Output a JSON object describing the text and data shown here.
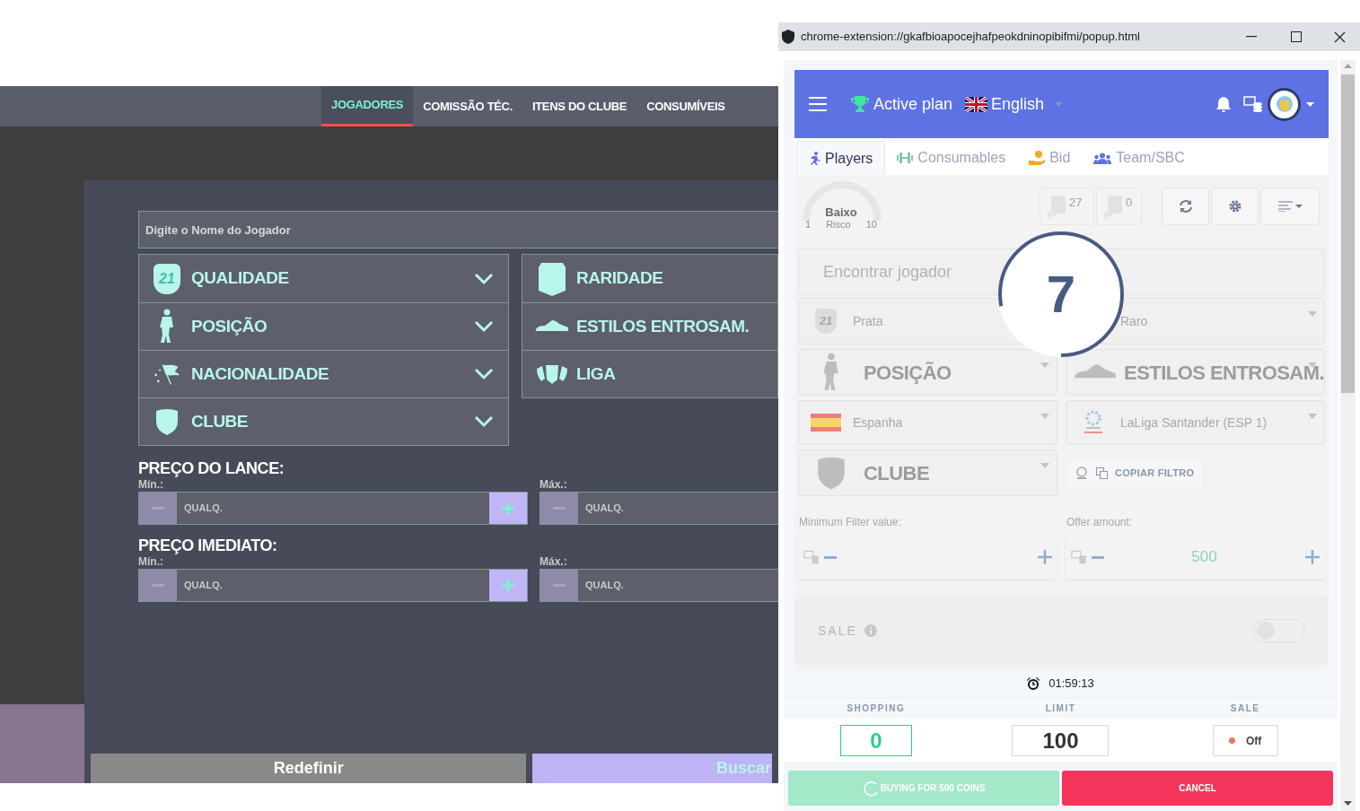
{
  "game": {
    "nav_tabs": [
      {
        "label": "JOGADORES",
        "selected": true
      },
      {
        "label": "COMISSÃO TÉC.",
        "selected": false
      },
      {
        "label": "ITENS DO CLUBE",
        "selected": false
      },
      {
        "label": "CONSUMÍVEIS",
        "selected": false
      }
    ],
    "search": {
      "placeholder": "Digite o Nome do Jogador"
    },
    "filters_left": [
      {
        "kind": "quality",
        "label": "QUALIDADE",
        "badge": "21"
      },
      {
        "kind": "position",
        "label": "POSIÇÃO"
      },
      {
        "kind": "nation",
        "label": "NACIONALIDADE"
      },
      {
        "kind": "club",
        "label": "CLUBE"
      }
    ],
    "filters_right": [
      {
        "kind": "rarity",
        "label": "RARIDADE"
      },
      {
        "kind": "chemistry",
        "label": "ESTILOS ENTROSAM."
      },
      {
        "kind": "league",
        "label": "LIGA"
      }
    ],
    "prices": [
      {
        "title": "PREÇO DO LANCE:",
        "min_label": "Mín.:",
        "max_label": "Máx.:",
        "min_placeholder": "QUALQ.",
        "max_placeholder": "QUALQ."
      },
      {
        "title": "PREÇO IMEDIATO:",
        "min_label": "Mín.:",
        "max_label": "Máx.:",
        "min_placeholder": "QUALQ.",
        "max_placeholder": "QUALQ."
      }
    ],
    "reset_button": "Redefinir",
    "search_button": "Buscar"
  },
  "popup": {
    "window": {
      "title": "chrome-extension://gkafbioapocejhafpeokdninopibifmi/popup.html"
    },
    "header": {
      "plan": "Active plan",
      "language": "English"
    },
    "tabs": [
      {
        "label": "Players",
        "selected": true
      },
      {
        "label": "Consumables",
        "selected": false
      },
      {
        "label": "Bid",
        "selected": false
      },
      {
        "label": "Team/SBC",
        "selected": false
      }
    ],
    "risk": {
      "value": "Baixo",
      "label": "Risco",
      "min": "1",
      "max": "10"
    },
    "counters": [
      {
        "value": "27"
      },
      {
        "value": "0"
      }
    ],
    "search": {
      "placeholder": "Encontrar jogador"
    },
    "filters": [
      {
        "kind": "select",
        "badge": "21",
        "text": "Prata"
      },
      {
        "kind": "select",
        "text": "Raro"
      },
      {
        "kind": "big",
        "text": "POSIÇÃO"
      },
      {
        "kind": "big",
        "text": "ESTILOS ENTROSAM."
      },
      {
        "kind": "select",
        "text": "Espanha"
      },
      {
        "kind": "select",
        "text": "LaLiga Santander (ESP 1)"
      },
      {
        "kind": "big",
        "text": "CLUBE"
      },
      {
        "kind": "action",
        "text": "COPIAR FILTRO"
      }
    ],
    "min_filter": {
      "label": "Minimum Filter value:"
    },
    "offer": {
      "label": "Offer amount:",
      "value": "500"
    },
    "sale": {
      "label": "SALE",
      "on": false
    },
    "timer": "01:59:13",
    "stats": [
      {
        "label": "SHOPPING",
        "value": "0",
        "highlighted": true
      },
      {
        "label": "LIMIT",
        "value": "100",
        "highlighted": false
      }
    ],
    "sale_status": {
      "label": "SALE",
      "value": "Off",
      "on": false
    },
    "buy_button": "BUYING FOR 500 COINS",
    "cancel_button": "CANCEL",
    "countdown": {
      "value": "7"
    }
  }
}
